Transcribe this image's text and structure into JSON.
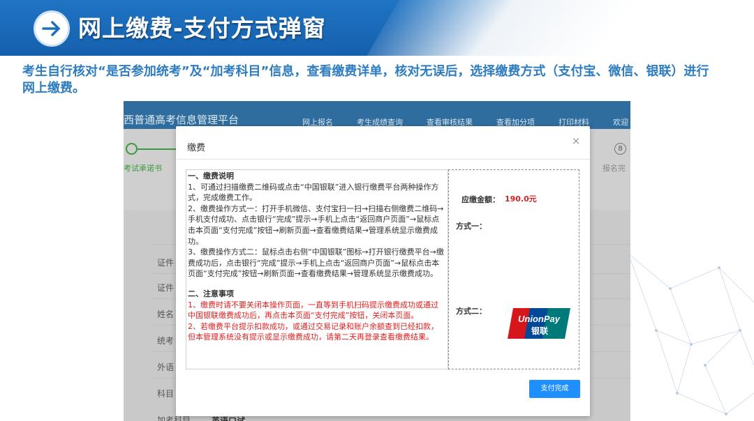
{
  "slide": {
    "title": "网上缴费-支付方式弹窗",
    "intro": "考生自行核对“是否参加统考”及“加考科目”信息，查看缴费详单，核对无误后，选择缴费方式（支付宝、微信、银联）进行网上缴费。"
  },
  "portal": {
    "name": "西普通高考信息管理平台",
    "nav": [
      "网上报名",
      "考生成绩查询",
      "查看审核结果",
      "查看加分项",
      "打印材料",
      "欢迎"
    ],
    "step_first": "考试承诺书",
    "step_last_number": "8",
    "step_last": "报名完",
    "form_labels": [
      "证件",
      "证件",
      "姓名",
      "统考",
      "外语",
      "科目",
      "加考科目"
    ],
    "form_foot": "英语口试"
  },
  "modal": {
    "title": "缴费",
    "close_glyph": "×",
    "section1_heading": "一、缴费说明",
    "section1_items": [
      "1、可通过扫描缴费二维码或点击“中国银联”进入银行缴费平台两种操作方式，完成缴费工作。",
      "2、缴费操作方式一：打开手机微信、支付宝扫一扫→扫描右侧缴费二维码→手机支付成功、点击银行“完成”提示→手机上点击“返回商户页面”→鼠标点击本页面“支付完成”按钮→刷新页面→查看缴费结果→管理系统显示缴费成功。",
      "3、缴费操作方式二：鼠标点击右侧“中国银联”图标→打开银行缴费平台→缴费成功后，点击银行“完成”提示→手机上点击“返回商户页面”→鼠标点击本页面“支付完成”按钮→刷新页面→查看缴费结果→管理系统显示缴费成功。"
    ],
    "section2_heading": "二、注意事项",
    "section2_items": [
      "1、缴费时请不要关闭本操作页面，一直等到手机扫码提示缴费成功或通过中国银联缴费成功后，再点击本页面“支付完成”按钮，关闭本页面。",
      "2、若缴费平台提示扣款成功，或通过交易记录和账户余额查到已经扣款，但本管理系统没有提示或显示缴费成功，请第二天再登录查看缴费结果。"
    ],
    "amount_label": "应缴金额：",
    "amount_value": "190.0元",
    "method1_label": "方式一：",
    "method2_label": "方式二：",
    "unionpay_text1": "UnionPay",
    "unionpay_text2": "银联",
    "done_button": "支付完成"
  },
  "colors": {
    "header_blue": "#1f74c4",
    "intro_blue": "#2d7cc0",
    "warning_red": "#e02020",
    "button_blue": "#1e8fff"
  }
}
